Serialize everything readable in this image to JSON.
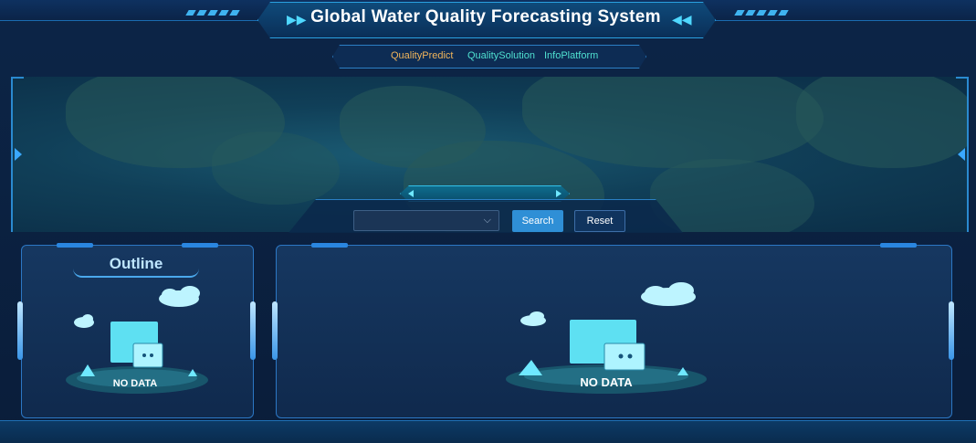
{
  "header": {
    "title": "Global Water Quality Forecasting System"
  },
  "nav": {
    "items": [
      {
        "label": "QualityPredict",
        "active": true
      },
      {
        "label": "QualitySolution",
        "active": false
      },
      {
        "label": "InfoPlatform",
        "active": false
      }
    ]
  },
  "search": {
    "select_value": "",
    "search_label": "Search",
    "reset_label": "Reset"
  },
  "outline_panel": {
    "title": "Outline",
    "empty_label": "NO DATA"
  },
  "main_panel": {
    "empty_label": "NO DATA"
  },
  "colors": {
    "accent": "#2f8fd6",
    "nav_active": "#f0b45a",
    "nav_normal": "#4fe0d0",
    "frame": "#2c77c4"
  }
}
